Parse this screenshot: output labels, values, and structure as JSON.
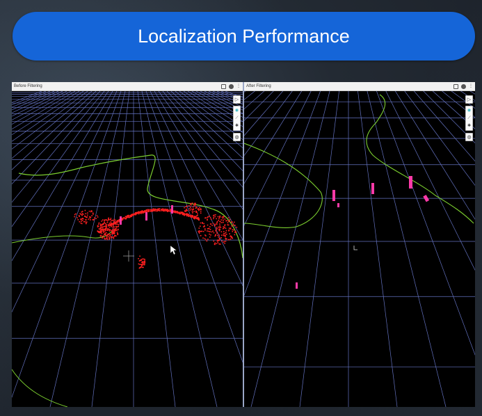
{
  "slide": {
    "title": "Localization Performance"
  },
  "viewers": [
    {
      "title": "Before Filtering"
    },
    {
      "title": "After Filtering"
    }
  ],
  "toolbar_icons": [
    "play-icon",
    "layers-icon",
    "ruler-icon",
    "settings-icon",
    "eye-icon"
  ],
  "colors": {
    "title_pill": "#1565d8",
    "grid": "#6f7fd6",
    "boundary": "#7ccf2f",
    "raw_points": "#ff2020",
    "filtered_points": "#ff3aa8"
  }
}
